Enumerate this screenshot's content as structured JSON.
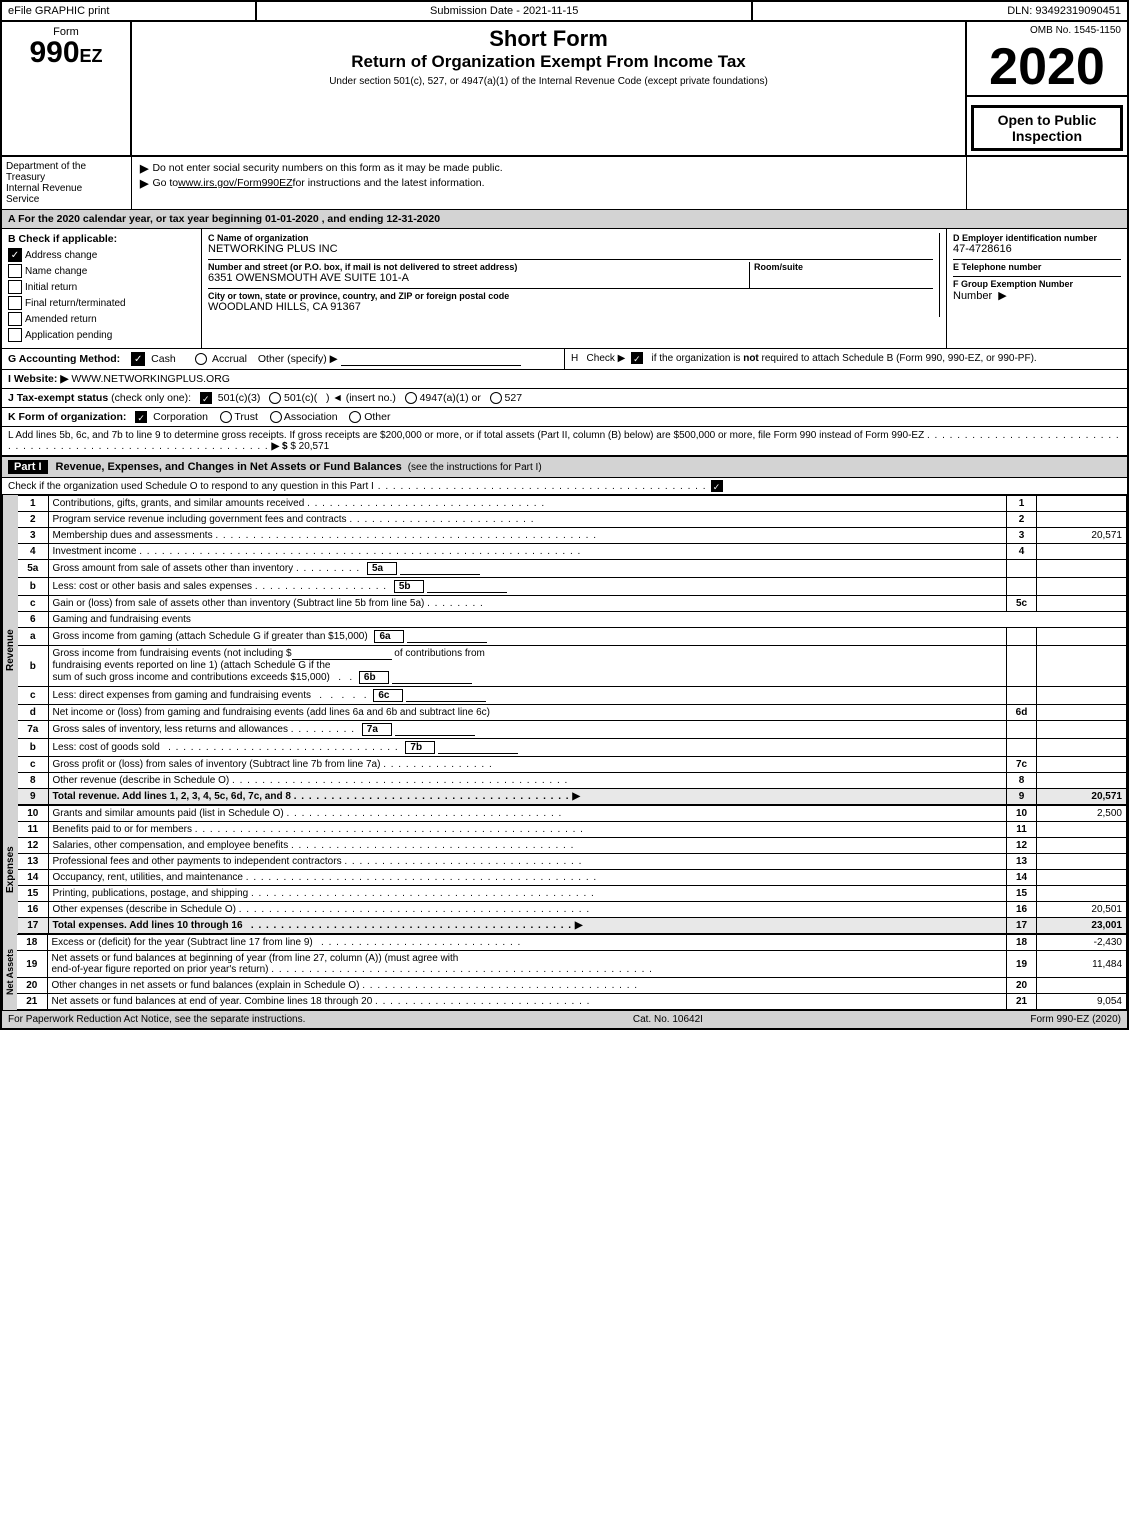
{
  "topbar": {
    "left_label": "eFile GRAPHIC print",
    "mid_label": "Submission Date - 2021-11-15",
    "right_label": "DLN: 93492319090451"
  },
  "form": {
    "word": "Form",
    "number": "990",
    "ez": "EZ"
  },
  "header": {
    "title1": "Short Form",
    "title2": "Return of Organization Exempt From Income Tax",
    "subtitle": "Under section 501(c), 527, or 4947(a)(1) of the Internal Revenue Code (except private foundations)",
    "year": "2020",
    "open_inspection": "Open to Public Inspection"
  },
  "omb": {
    "label": "OMB No. 1545-1150"
  },
  "dept": {
    "line1": "Department of the",
    "line2": "Treasury",
    "line3": "Internal Revenue",
    "line4": "Service"
  },
  "instructions": {
    "arrow1": "▶",
    "text1": "Do not enter social security numbers on this form as it may be made public.",
    "arrow2": "▶",
    "text2": "Go to ",
    "link2": "www.irs.gov/Form990EZ",
    "text2b": " for instructions and the latest information."
  },
  "tax_year": {
    "text": "A For the 2020 calendar year, or tax year beginning 01-01-2020 , and ending 12-31-2020"
  },
  "section_b": {
    "label": "B Check if applicable:",
    "items": [
      {
        "id": "address_change",
        "label": "Address change",
        "checked": true
      },
      {
        "id": "name_change",
        "label": "Name change",
        "checked": false
      },
      {
        "id": "initial_return",
        "label": "Initial return",
        "checked": false
      },
      {
        "id": "final_return",
        "label": "Final return/terminated",
        "checked": false
      },
      {
        "id": "amended_return",
        "label": "Amended return",
        "checked": false
      },
      {
        "id": "application_pending",
        "label": "Application pending",
        "checked": false
      }
    ]
  },
  "section_c": {
    "name_label": "C Name of organization",
    "name_value": "NETWORKING PLUS INC",
    "address_label": "Number and street (or P.O. box, if mail is not delivered to street address)",
    "address_value": "6351 OWENSMOUTH AVE SUITE 101-A",
    "room_label": "Room/suite",
    "room_value": "",
    "city_label": "City or town, state or province, country, and ZIP or foreign postal code",
    "city_value": "WOODLAND HILLS, CA  91367"
  },
  "section_d": {
    "ein_label": "D Employer identification number",
    "ein_value": "47-4728616",
    "tel_label": "E Telephone number",
    "tel_value": "",
    "group_label": "F Group Exemption Number",
    "group_value": ""
  },
  "section_g": {
    "label": "G Accounting Method:",
    "cash_label": "Cash",
    "accrual_label": "Accrual",
    "other_label": "Other (specify) ▶",
    "cash_checked": true
  },
  "section_h": {
    "text": "H  Check ▶  ☑ if the organization is not required to attach Schedule B (Form 990, 990-EZ, or 990-PF)."
  },
  "section_i": {
    "label": "I Website: ▶",
    "value": "WWW.NETWORKINGPLUS.ORG"
  },
  "section_j": {
    "text": "J Tax-exempt status (check only one): ☑ 501(c)(3)  ○ 501(c)(   ) ◄ (insert no.)  ○ 4947(a)(1) or  ○ 527"
  },
  "section_k": {
    "text": "K Form of organization:  ☑ Corporation   ○ Trust   ○ Association   ○ Other"
  },
  "section_l": {
    "text": "L Add lines 5b, 6c, and 7b to line 9 to determine gross receipts. If gross receipts are $200,000 or more, or if total assets (Part II, column (B) below) are $500,000 or more, file Form 990 instead of Form 990-EZ",
    "dots": ". . . . . . . . . . . . . . . . . . . . . . . . . . . . . . . . . . . . . . . . . . . . . . . . . . . . . .",
    "arrow": "▶",
    "value": "$ 20,571"
  },
  "part1": {
    "header": "Part I",
    "title": "Revenue, Expenses, and Changes in Net Assets or Fund Balances",
    "subtitle": "(see the instructions for Part I)",
    "check_text": "Check if the organization used Schedule O to respond to any question in this Part I",
    "check_dots": ". . . . . . . . . . . . . . . . . . . . . . . . .",
    "check_checked": true,
    "lines": [
      {
        "num": "1",
        "desc": "Contributions, gifts, grants, and similar amounts received",
        "dots": ". . . . . . . . . . . . . . . . . . . . . . . . . . . . . . . .",
        "line_num": "1",
        "value": ""
      },
      {
        "num": "2",
        "desc": "Program service revenue including government fees and contracts",
        "dots": ". . . . . . . . . . . . . . . . . . . . . . . . .",
        "line_num": "2",
        "value": ""
      },
      {
        "num": "3",
        "desc": "Membership dues and assessments",
        "dots": ". . . . . . . . . . . . . . . . . . . . . . . . . . . . . . . . . . . . . . . . . . . . . .",
        "line_num": "3",
        "value": "20,571"
      },
      {
        "num": "4",
        "desc": "Investment income",
        "dots": ". . . . . . . . . . . . . . . . . . . . . . . . . . . . . . . . . . . . . . . . . . . . . . . . . . . . . . . . .",
        "line_num": "4",
        "value": ""
      }
    ],
    "line_5a": {
      "desc": "Gross amount from sale of assets other than inventory",
      "dots": ". . . . . . . . .",
      "box_label": "5a",
      "value": ""
    },
    "line_5b": {
      "desc": "Less: cost or other basis and sales expenses",
      "dots": ". . . . . . . . . . . . . . . . .",
      "box_label": "5b",
      "value": ""
    },
    "line_5c": {
      "desc": "Gain or (loss) from sale of assets other than inventory (Subtract line 5b from line 5a)",
      "dots": ". . . . . . . .",
      "line_num": "5c",
      "value": ""
    },
    "line_6": {
      "desc": "Gaming and fundraising events"
    },
    "line_6a": {
      "desc": "Gross income from gaming (attach Schedule G if greater than $15,000)",
      "box_label": "6a",
      "value": ""
    },
    "line_6b_pre": "Gross income from fundraising events (not including $",
    "line_6b_mid": "of contributions from",
    "line_6b_desc2": "fundraising events reported on line 1) (attach Schedule G if the",
    "line_6b_desc3": "sum of such gross income and contributions exceeds $15,000)",
    "line_6b_box": "6b",
    "line_6b_value": "",
    "line_6c": {
      "desc": "Less: direct expenses from gaming and fundraising events",
      "dots": ". . . . .",
      "box_label": "6c",
      "value": ""
    },
    "line_6d": {
      "desc": "Net income or (loss) from gaming and fundraising events (add lines 6a and 6b and subtract line 6c)",
      "line_num": "6d",
      "value": ""
    },
    "line_7a": {
      "desc": "Gross sales of inventory, less returns and allowances",
      "dots": ". . . . . . . .",
      "box_label": "7a",
      "value": ""
    },
    "line_7b": {
      "desc": "Less: cost of goods sold",
      "dots": ". . . . . . . . . . . . . . . . . . . . . . . . . . . . . . .",
      "box_label": "7b",
      "value": ""
    },
    "line_7c": {
      "desc": "Gross profit or (loss) from sales of inventory (Subtract line 7b from line 7a)",
      "dots": ". . . . . . . . . . . . . .",
      "line_num": "7c",
      "value": ""
    },
    "line_8": {
      "desc": "Other revenue (describe in Schedule O)",
      "dots": ". . . . . . . . . . . . . . . . . . . . . . . . . . . . . . . . . . . . . . . . . . .",
      "line_num": "8",
      "value": ""
    },
    "line_9": {
      "desc": "Total revenue. Add lines 1, 2, 3, 4, 5c, 6d, 7c, and 8",
      "dots": ". . . . . . . . . . . . . . . . . . . . . . . . . . . . . . . . . . . .",
      "arrow": "▶",
      "line_num": "9",
      "value": "20,571"
    }
  },
  "expenses": {
    "label": "Expenses",
    "lines": [
      {
        "num": "10",
        "desc": "Grants and similar amounts paid (list in Schedule O)",
        "dots": ". . . . . . . . . . . . . . . . . . . . . . . . . . . . . . . . . . .",
        "line_num": "10",
        "value": "2,500"
      },
      {
        "num": "11",
        "desc": "Benefits paid to or for members",
        "dots": ". . . . . . . . . . . . . . . . . . . . . . . . . . . . . . . . . . . . . . . . . . . . . . . . . . . .",
        "line_num": "11",
        "value": ""
      },
      {
        "num": "12",
        "desc": "Salaries, other compensation, and employee benefits",
        "dots": ". . . . . . . . . . . . . . . . . . . . . . . . . . . . . . . . . . . . . .",
        "line_num": "12",
        "value": ""
      },
      {
        "num": "13",
        "desc": "Professional fees and other payments to independent contractors",
        "dots": ". . . . . . . . . . . . . . . . . . . . . . . . . . . . . . . .",
        "line_num": "13",
        "value": ""
      },
      {
        "num": "14",
        "desc": "Occupancy, rent, utilities, and maintenance",
        "dots": ". . . . . . . . . . . . . . . . . . . . . . . . . . . . . . . . . . . . . . . . . . . . . .",
        "line_num": "14",
        "value": ""
      },
      {
        "num": "15",
        "desc": "Printing, publications, postage, and shipping",
        "dots": ". . . . . . . . . . . . . . . . . . . . . . . . . . . . . . . . . . . . . . . . . . . . .",
        "line_num": "15",
        "value": ""
      },
      {
        "num": "16",
        "desc": "Other expenses (describe in Schedule O)",
        "dots": ". . . . . . . . . . . . . . . . . . . . . . . . . . . . . . . . . . . . . . . . . . . . . .",
        "line_num": "16",
        "value": "20,501"
      },
      {
        "num": "17",
        "desc": "Total expenses. Add lines 10 through 16",
        "dots": ". . . . . . . . . . . . . . . . . . . . . . . . . . . . . . . . . . . . . . . . . . . .",
        "arrow": "▶",
        "line_num": "17",
        "value": "23,001",
        "bold": true
      }
    ]
  },
  "net_assets": {
    "label": "Net Assets",
    "lines": [
      {
        "num": "18",
        "desc": "Excess or (deficit) for the year (Subtract line 17 from line 9)",
        "dots": ". . . . . . . . . . . . . . . . . . . . . . . . . . .",
        "line_num": "18",
        "value": "-2,430"
      },
      {
        "num": "19",
        "desc": "Net assets or fund balances at beginning of year (from line 27, column (A)) (must agree with end-of-year figure reported on prior year's return)",
        "dots": ". . . . . . . . . . . . . . . . . . . . . . . . . . . . . . . . . . . . . . . . . . . . . . . . . . .",
        "line_num": "19",
        "value": "11,484"
      },
      {
        "num": "20",
        "desc": "Other changes in net assets or fund balances (explain in Schedule O)",
        "dots": ". . . . . . . . . . . . . . . . . . . . . . . . . . . . . . . . . . . . . .",
        "line_num": "20",
        "value": ""
      },
      {
        "num": "21",
        "desc": "Net assets or fund balances at end of year. Combine lines 18 through 20",
        "dots": ". . . . . . . . . . . . . . . . . . . . . . . . . . . .",
        "line_num": "21",
        "value": "9,054"
      }
    ]
  },
  "footer": {
    "left": "For Paperwork Reduction Act Notice, see the separate instructions.",
    "center": "Cat. No. 10642I",
    "right": "Form 990-EZ (2020)"
  }
}
